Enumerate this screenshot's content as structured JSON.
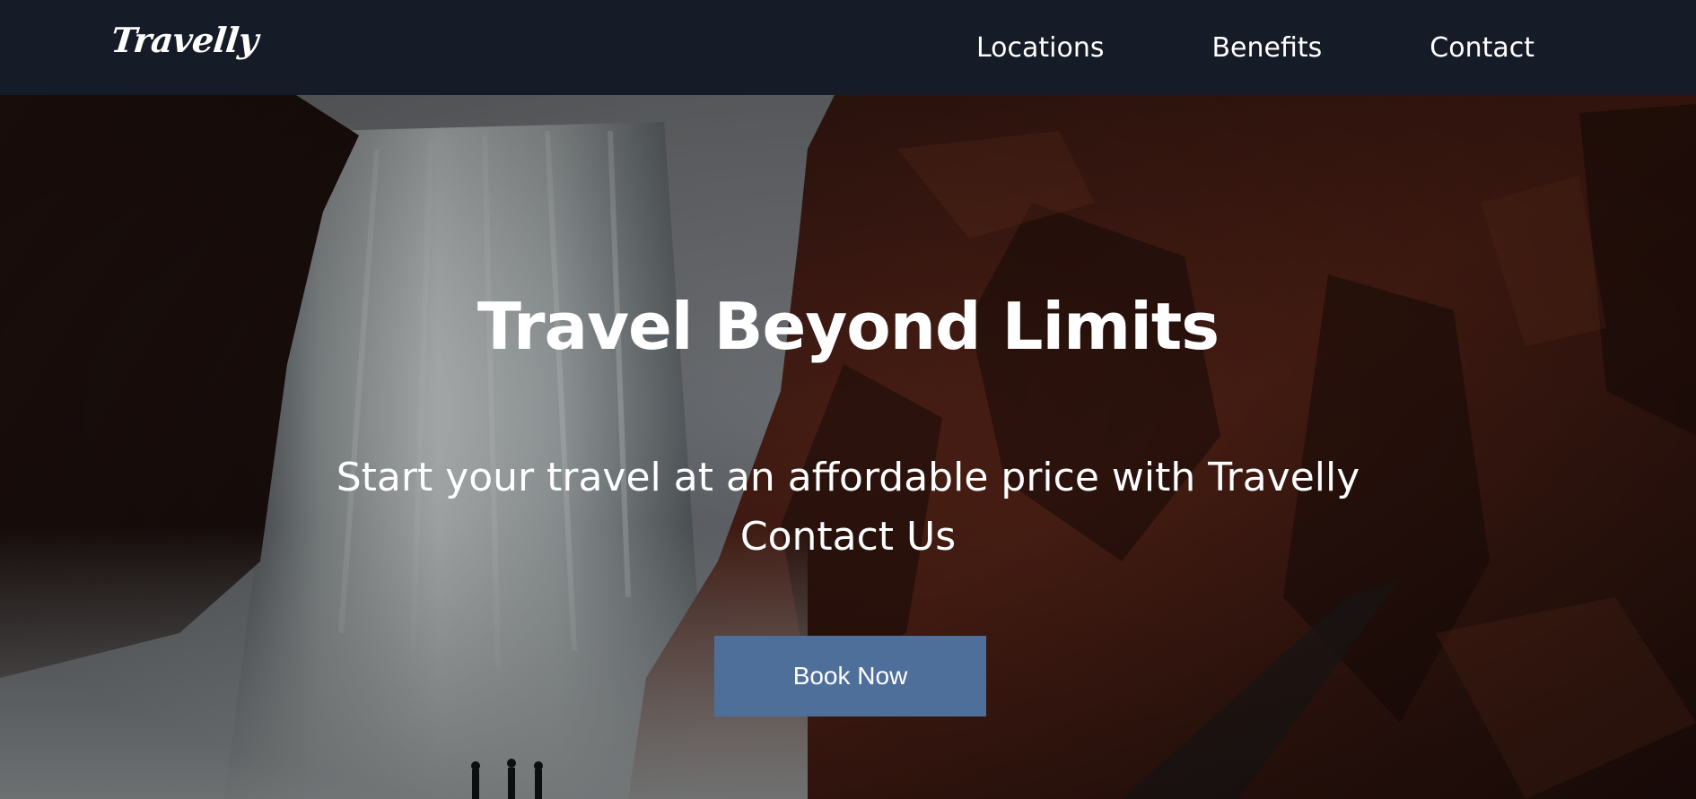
{
  "brand": {
    "logo_text": "Travelly"
  },
  "nav": {
    "items": [
      {
        "label": "Locations"
      },
      {
        "label": "Benefits"
      },
      {
        "label": "Contact"
      }
    ]
  },
  "hero": {
    "title": "Travel Beyond Limits",
    "subtitle_line1": "Start your travel at an affordable price with Travelly",
    "subtitle_line2": "Contact Us",
    "cta_label": "Book Now"
  },
  "colors": {
    "navbar_bg": "#161c27",
    "cta_bg": "#4f6f9b",
    "text": "#ffffff"
  }
}
